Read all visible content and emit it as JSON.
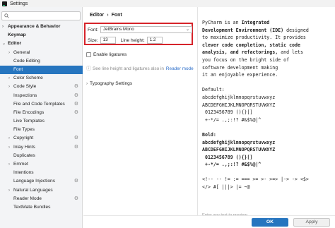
{
  "window": {
    "title": "Settings"
  },
  "sidebar": {
    "search_placeholder": "",
    "items": [
      {
        "label": "Appearance & Behavior",
        "arrow": "›",
        "bold": true
      },
      {
        "label": "Keymap",
        "arrow": "",
        "bold": true
      },
      {
        "label": "Editor",
        "arrow": "⌄",
        "bold": true
      },
      {
        "label": "General",
        "arrow": "›"
      },
      {
        "label": "Code Editing",
        "arrow": ""
      },
      {
        "label": "Font",
        "arrow": "",
        "selected": true
      },
      {
        "label": "Color Scheme",
        "arrow": "›"
      },
      {
        "label": "Code Style",
        "arrow": "›",
        "gear": true
      },
      {
        "label": "Inspections",
        "arrow": "",
        "gear": true
      },
      {
        "label": "File and Code Templates",
        "arrow": "",
        "gear": true
      },
      {
        "label": "File Encodings",
        "arrow": "",
        "gear": true
      },
      {
        "label": "Live Templates",
        "arrow": ""
      },
      {
        "label": "File Types",
        "arrow": ""
      },
      {
        "label": "Copyright",
        "arrow": "›",
        "gear": true
      },
      {
        "label": "Inlay Hints",
        "arrow": "›",
        "gear": true
      },
      {
        "label": "Duplicates",
        "arrow": ""
      },
      {
        "label": "Emmet",
        "arrow": "›"
      },
      {
        "label": "Intentions",
        "arrow": ""
      },
      {
        "label": "Language Injections",
        "arrow": "",
        "gear": true
      },
      {
        "label": "Natural Languages",
        "arrow": "›"
      },
      {
        "label": "Reader Mode",
        "arrow": "",
        "gear": true
      },
      {
        "label": "TextMate Bundles",
        "arrow": ""
      }
    ]
  },
  "header": {
    "crumb1": "Editor",
    "sep": "›",
    "crumb2": "Font"
  },
  "font_settings": {
    "font_label": "Font:",
    "font_value": "JetBrains Mono",
    "size_label": "Size:",
    "size_value": "13",
    "line_height_label": "Line height:",
    "line_height_value": "1.2",
    "ligatures_label": "Enable ligatures",
    "info_text": "See line height and ligatures also in",
    "info_link": "Reader mode",
    "typography_label": "Typography Settings"
  },
  "preview": {
    "intro_prefix": "PyCharm is an ",
    "intro_bold1": "Integrated",
    "line2_bold": "Development Environment (IDE)",
    "line2_rest": " designed",
    "line3": "to maximize productivity. It provides",
    "line4_bold": "clever code completion, static code",
    "line5_bold": "analysis, and refactorings,",
    "line5_rest": " and lets",
    "line6": "you focus on the bright side of",
    "line7": "software development making",
    "line8": "it an enjoyable experience.",
    "default_label": "Default:",
    "sample_lower": "abcdefghijklmnopqrstuvwxyz",
    "sample_upper": "ABCDEFGHIJKLMNOPQRSTUVWXYZ",
    "sample_digits": " 0123456789 (){}[]",
    "sample_symbols": " +-*/= .,;:!? #&$%@|^",
    "bold_label": "Bold:",
    "lig_line1": "<!-- -- != := === >= >- >=> |-> -> <$>",
    "lig_line2": "</> #[ |||> |= ~@",
    "placeholder": "Enter any text to preview"
  },
  "footer": {
    "ok_label": "OK",
    "apply_label": "Apply"
  }
}
